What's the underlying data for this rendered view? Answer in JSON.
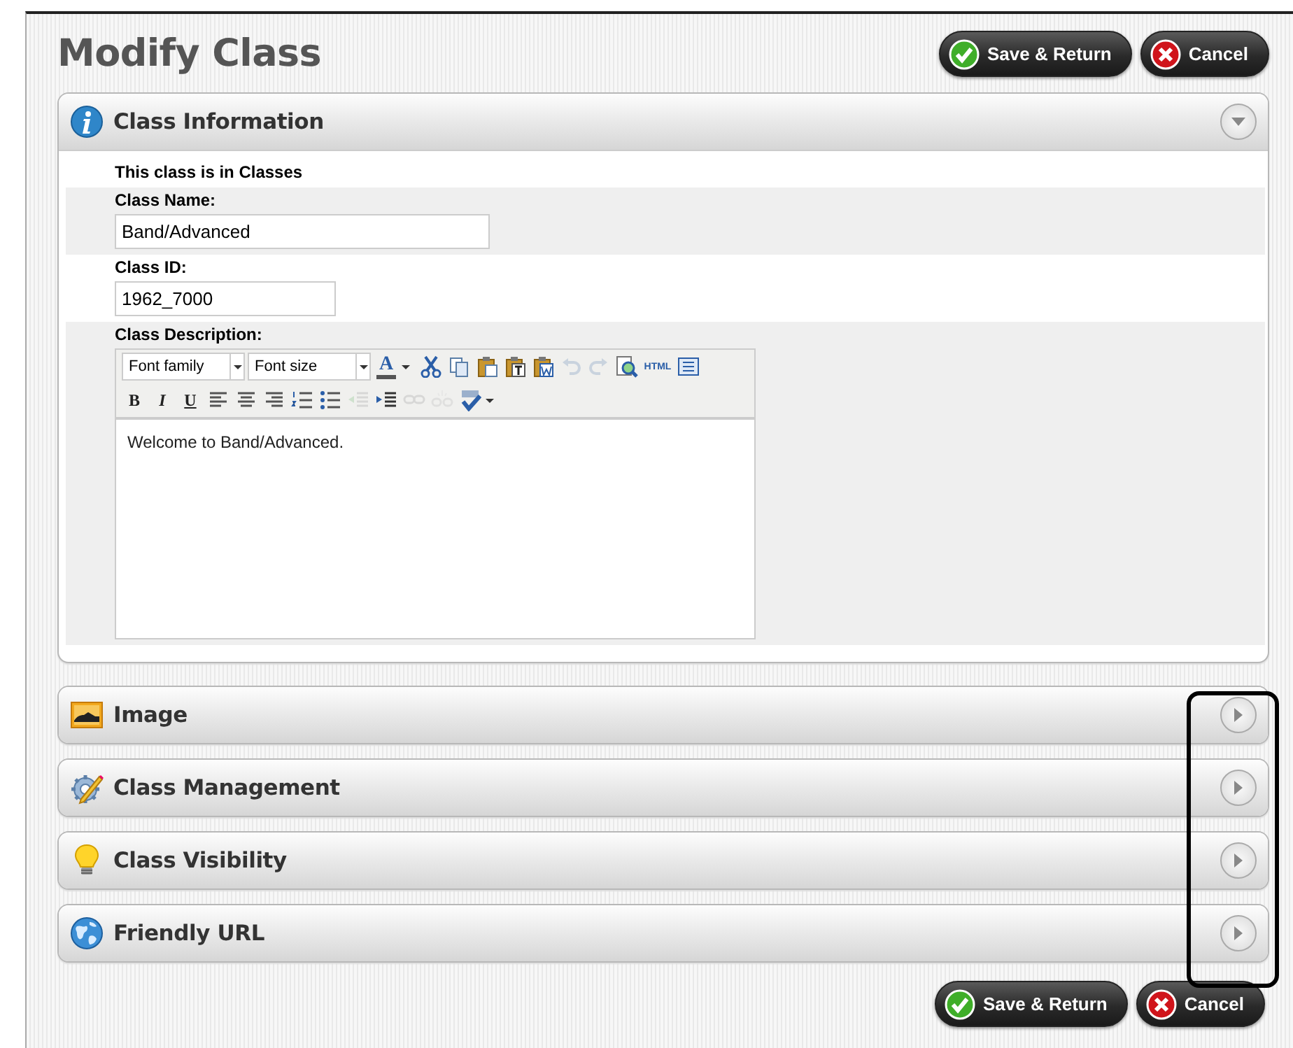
{
  "page": {
    "title": "Modify Class"
  },
  "top_buttons": [
    {
      "kind": "save",
      "label": "Save & Return"
    },
    {
      "kind": "cancel",
      "label": "Cancel"
    }
  ],
  "sections": [
    {
      "kind": "info",
      "title": "Class Information",
      "expanded": true,
      "rows": [
        {
          "kind": "note",
          "text": "This class is in Classes"
        },
        {
          "kind": "text",
          "label": "Class Name:",
          "value": "Band/Advanced"
        },
        {
          "kind": "text",
          "label": "Class ID:",
          "value": "1962_7000"
        },
        {
          "kind": "editor",
          "label": "Class Description:",
          "font_family": "Font family",
          "font_size": "Font size",
          "content": "Welcome to Band/Advanced.",
          "toolbar": [
            [
              {
                "kind": "forecolor",
                "glyph": "A",
                "disabled": false
              },
              {
                "kind": "cut",
                "disabled": false
              },
              {
                "kind": "copy",
                "disabled": false
              },
              {
                "kind": "paste",
                "disabled": false
              },
              {
                "kind": "pastetext",
                "disabled": false
              },
              {
                "kind": "pasteword",
                "disabled": false
              },
              {
                "kind": "undo",
                "disabled": true
              },
              {
                "kind": "redo",
                "disabled": true
              },
              {
                "kind": "preview",
                "disabled": false
              },
              {
                "kind": "html",
                "glyph": "HTML",
                "disabled": false
              },
              {
                "kind": "fullscreen",
                "disabled": false
              }
            ],
            [
              {
                "kind": "bold",
                "glyph": "B",
                "disabled": false
              },
              {
                "kind": "italic",
                "glyph": "I",
                "disabled": false
              },
              {
                "kind": "underline",
                "glyph": "U",
                "disabled": false
              },
              {
                "kind": "alignleft",
                "disabled": false
              },
              {
                "kind": "aligncenter",
                "disabled": false
              },
              {
                "kind": "alignright",
                "disabled": false
              },
              {
                "kind": "numlist",
                "disabled": false
              },
              {
                "kind": "bullist",
                "disabled": false
              },
              {
                "kind": "outdent",
                "disabled": true
              },
              {
                "kind": "indent",
                "disabled": false
              },
              {
                "kind": "link",
                "disabled": true
              },
              {
                "kind": "unlink",
                "disabled": true
              },
              {
                "kind": "spellcheck",
                "disabled": false
              }
            ]
          ]
        }
      ]
    },
    {
      "kind": "image",
      "title": "Image",
      "expanded": false
    },
    {
      "kind": "management",
      "title": "Class Management",
      "expanded": false
    },
    {
      "kind": "visibility",
      "title": "Class Visibility",
      "expanded": false
    },
    {
      "kind": "url",
      "title": "Friendly URL",
      "expanded": false
    }
  ],
  "bottom_buttons": [
    {
      "kind": "save",
      "label": "Save & Return"
    },
    {
      "kind": "cancel",
      "label": "Cancel"
    }
  ]
}
